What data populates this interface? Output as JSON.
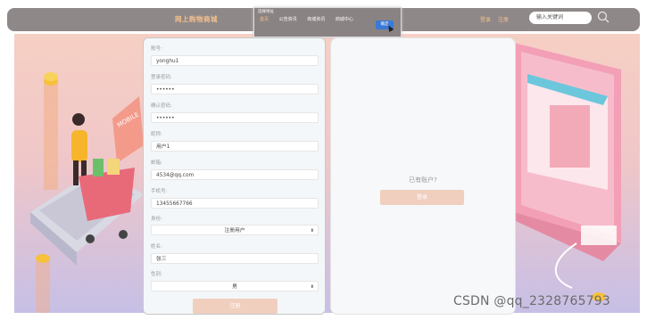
{
  "header": {
    "site_title": "网上购物商城",
    "login": "登录",
    "register": "注册",
    "search_placeholder": "输入关键词"
  },
  "nav_popup": {
    "hint": "选择地址",
    "items": [
      "首页",
      "公告资讯",
      "商城资讯",
      "商城中心"
    ],
    "confirm_label": "确定"
  },
  "form": {
    "fields": [
      {
        "label": "账号:",
        "value": "yonghu1"
      },
      {
        "label": "登录密码:",
        "value": "••••••"
      },
      {
        "label": "确认密码:",
        "value": "••••••"
      },
      {
        "label": "昵称:",
        "value": "用户1"
      },
      {
        "label": "邮箱:",
        "value": "4534@qq.com"
      },
      {
        "label": "手机号:",
        "value": "13455667766"
      },
      {
        "label": "身份:",
        "value": "注册用户"
      },
      {
        "label": "姓名:",
        "value": "张三"
      },
      {
        "label": "性别:",
        "value": "男"
      }
    ],
    "submit_label": "注册"
  },
  "side": {
    "prompt": "已有账户?",
    "login_label": "登录"
  },
  "watermark": "CSDN @qq_2328765793"
}
